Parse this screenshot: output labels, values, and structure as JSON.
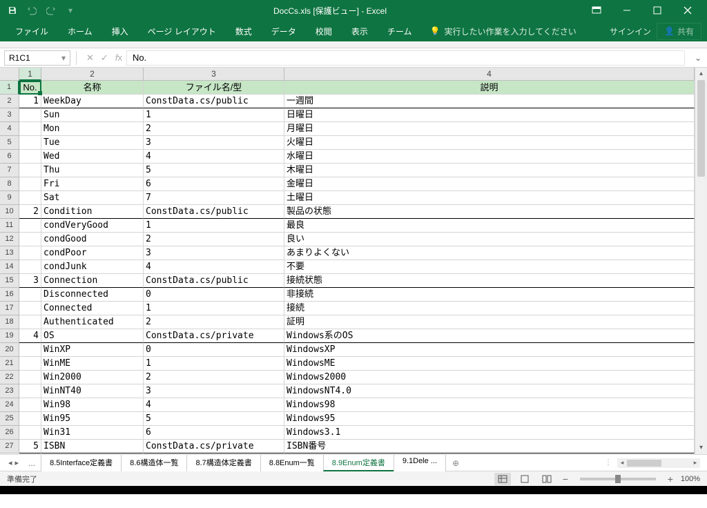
{
  "title": "DocCs.xls  [保護ビュー] - Excel",
  "qat": {
    "save": "save-icon",
    "undo": "undo-icon",
    "redo": "redo-icon"
  },
  "ribbon": {
    "tabs": [
      "ファイル",
      "ホーム",
      "挿入",
      "ページ レイアウト",
      "数式",
      "データ",
      "校閲",
      "表示",
      "チーム"
    ],
    "tell_me": "実行したい作業を入力してください",
    "signin": "サインイン",
    "share": "共有"
  },
  "formula": {
    "name_box": "R1C1",
    "value": "No."
  },
  "col_headers": [
    "1",
    "2",
    "3",
    "4"
  ],
  "header_row": [
    "No.",
    "名称",
    "ファイル名/型",
    "説明"
  ],
  "rows": [
    {
      "n": "1",
      "name": "WeekDay",
      "file": "ConstData.cs/public",
      "desc": "一週間",
      "sect": true
    },
    {
      "n": "",
      "name": "Sun",
      "file": "1",
      "desc": "日曜日"
    },
    {
      "n": "",
      "name": "Mon",
      "file": "2",
      "desc": "月曜日"
    },
    {
      "n": "",
      "name": "Tue",
      "file": "3",
      "desc": "火曜日"
    },
    {
      "n": "",
      "name": "Wed",
      "file": "4",
      "desc": "水曜日"
    },
    {
      "n": "",
      "name": "Thu",
      "file": "5",
      "desc": "木曜日"
    },
    {
      "n": "",
      "name": "Fri",
      "file": "6",
      "desc": "金曜日"
    },
    {
      "n": "",
      "name": "Sat",
      "file": "7",
      "desc": "土曜日"
    },
    {
      "n": "2",
      "name": "Condition",
      "file": "ConstData.cs/public",
      "desc": "製品の状態",
      "sect": true
    },
    {
      "n": "",
      "name": "condVeryGood",
      "file": "1",
      "desc": "最良"
    },
    {
      "n": "",
      "name": "condGood",
      "file": "2",
      "desc": "良い"
    },
    {
      "n": "",
      "name": "condPoor",
      "file": "3",
      "desc": "あまりよくない"
    },
    {
      "n": "",
      "name": "condJunk",
      "file": "4",
      "desc": "不要"
    },
    {
      "n": "3",
      "name": "Connection",
      "file": "ConstData.cs/public",
      "desc": "接続状態",
      "sect": true
    },
    {
      "n": "",
      "name": "Disconnected",
      "file": "0",
      "desc": "非接続"
    },
    {
      "n": "",
      "name": "Connected",
      "file": "1",
      "desc": "接続"
    },
    {
      "n": "",
      "name": "Authenticated",
      "file": "2",
      "desc": "証明"
    },
    {
      "n": "4",
      "name": "OS",
      "file": "ConstData.cs/private",
      "desc": "Windows系のOS",
      "sect": true
    },
    {
      "n": "",
      "name": "WinXP",
      "file": "0",
      "desc": "WindowsXP"
    },
    {
      "n": "",
      "name": "WinME",
      "file": "1",
      "desc": "WindowsME"
    },
    {
      "n": "",
      "name": "Win2000",
      "file": "2",
      "desc": "Windows2000"
    },
    {
      "n": "",
      "name": "WinNT40",
      "file": "3",
      "desc": "WindowsNT4.0"
    },
    {
      "n": "",
      "name": "Win98",
      "file": "4",
      "desc": "Windows98"
    },
    {
      "n": "",
      "name": "Win95",
      "file": "5",
      "desc": "Windows95"
    },
    {
      "n": "",
      "name": "Win31",
      "file": "6",
      "desc": "Windows3.1"
    },
    {
      "n": "5",
      "name": "ISBN",
      "file": "ConstData.cs/private",
      "desc": "ISBN番号",
      "sect": true
    }
  ],
  "row_numbers": [
    "1",
    "2",
    "3",
    "4",
    "5",
    "6",
    "7",
    "8",
    "9",
    "10",
    "11",
    "12",
    "13",
    "14",
    "15",
    "16",
    "17",
    "18",
    "19",
    "20",
    "21",
    "22",
    "23",
    "24",
    "25",
    "26",
    "27"
  ],
  "sheets": {
    "dots": "...",
    "tabs": [
      "8.5Interface定義書",
      "8.6構造体一覧",
      "8.7構造体定義書",
      "8.8Enum一覧",
      "8.9Enum定義書",
      "9.1Dele ..."
    ],
    "active_index": 4
  },
  "status": {
    "ready": "準備完了",
    "zoom": "100%"
  }
}
